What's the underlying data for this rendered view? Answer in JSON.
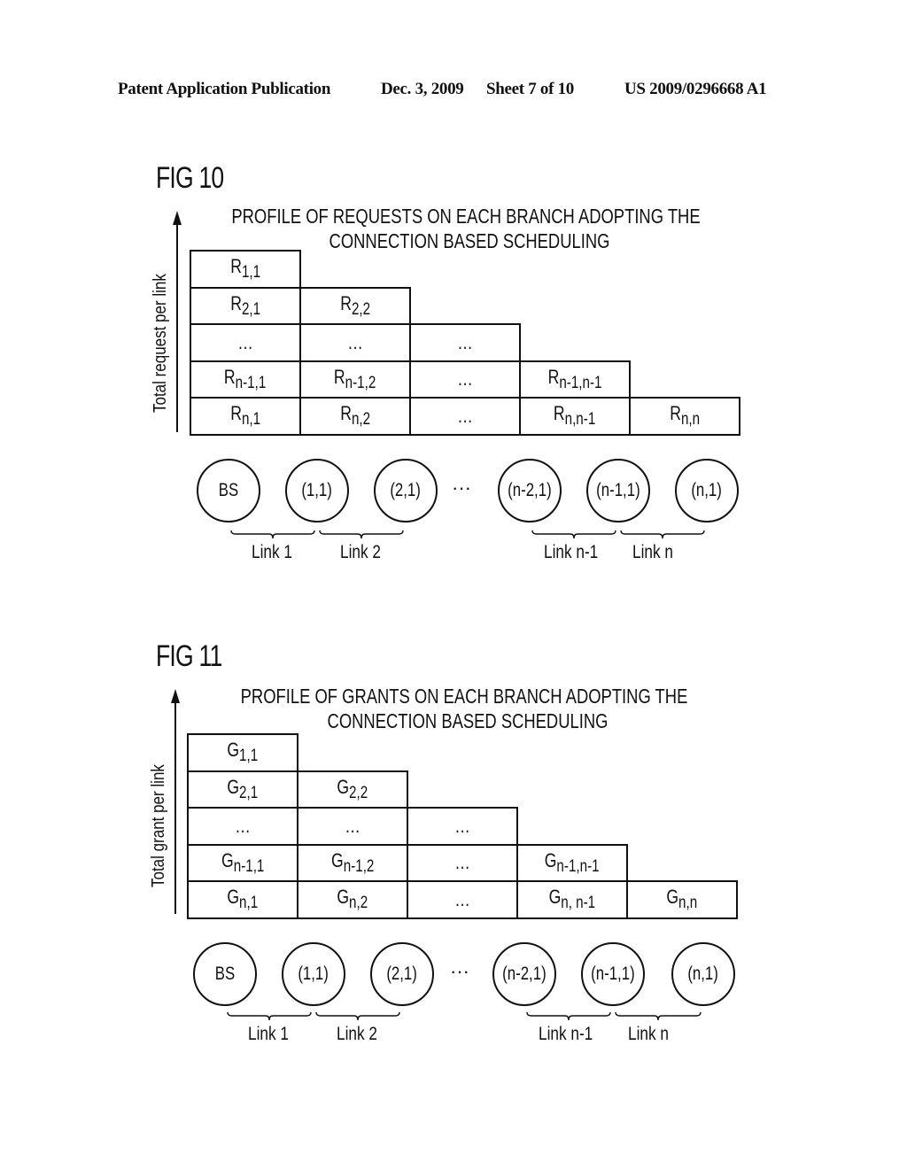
{
  "header": {
    "publication": "Patent Application Publication",
    "date": "Dec. 3, 2009",
    "sheet": "Sheet 7 of 10",
    "number": "US 2009/0296668 A1"
  },
  "figures": [
    {
      "label": "FIG 10",
      "title_line1": "PROFILE OF REQUESTS ON EACH BRANCH ADOPTING THE",
      "title_line2": "CONNECTION BASED SCHEDULING",
      "y_axis_label": "Total request per link",
      "rows": [
        [
          "R|1,1"
        ],
        [
          "R|2,1",
          "R|2,2"
        ],
        [
          "…",
          "…",
          "…"
        ],
        [
          "R|n-1,1",
          "R|n-1,2",
          "…",
          "R|n-1,n-1"
        ],
        [
          "R|n,1",
          "R|n,2",
          "…",
          "R|n,n-1",
          "R|n,n"
        ]
      ],
      "nodes": [
        "BS",
        "(1,1)",
        "(2,1)",
        "(n-2,1)",
        "(n-1,1)",
        "(n,1)"
      ],
      "nodes_ellipsis": "···",
      "links": [
        "Link 1",
        "Link 2",
        "Link n-1",
        "Link n"
      ]
    },
    {
      "label": "FIG 11",
      "title_line1": "PROFILE OF GRANTS ON EACH BRANCH ADOPTING THE",
      "title_line2": "CONNECTION BASED SCHEDULING",
      "y_axis_label": "Total grant per link",
      "rows": [
        [
          "G|1,1"
        ],
        [
          "G|2,1",
          "G|2,2"
        ],
        [
          "…",
          "…",
          "…"
        ],
        [
          "G|n-1,1",
          "G|n-1,2",
          "…",
          "G|n-1,n-1"
        ],
        [
          "G|n,1",
          "G|n,2",
          "…",
          "G|n, n-1",
          "G|n,n"
        ]
      ],
      "nodes": [
        "BS",
        "(1,1)",
        "(2,1)",
        "(n-2,1)",
        "(n-1,1)",
        "(n,1)"
      ],
      "nodes_ellipsis": "···",
      "links": [
        "Link 1",
        "Link 2",
        "Link n-1",
        "Link n"
      ]
    }
  ]
}
